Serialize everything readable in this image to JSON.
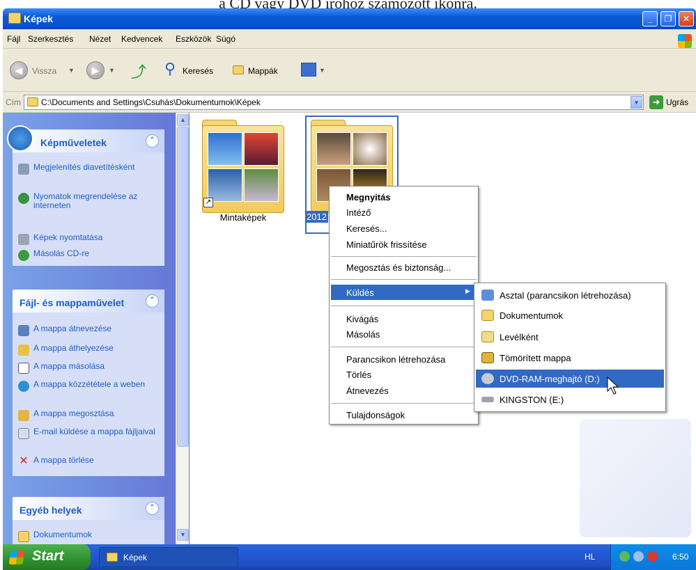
{
  "caption": "a CD vagy DVD íróhoz számozott ikonra.",
  "window": {
    "title": "Képek"
  },
  "menubar": [
    "Fájl",
    "Szerkesztés",
    "Nézet",
    "Kedvencek",
    "Eszközök",
    "Súgó"
  ],
  "toolbar": {
    "back": "Vissza",
    "search": "Keresés",
    "folders": "Mappák"
  },
  "address": {
    "label": "Cím",
    "path": "C:\\Documents and Settings\\Csuhás\\Dokumentumok\\Képek",
    "go": "Ugrás"
  },
  "sidebar": {
    "picture_tasks": {
      "title": "Képműveletek",
      "items": [
        "Megjelenítés diavetítésként",
        "Nyomatok megrendelése az interneten",
        "Képek nyomtatása",
        "Másolás CD-re"
      ]
    },
    "file_tasks": {
      "title": "Fájl- és mappaművelet",
      "items": [
        "A mappa átnevezése",
        "A mappa áthelyezése",
        "A mappa másolása",
        "A mappa közzététele a weben",
        "A mappa megosztása",
        "E-mail küldése a mappa fájljaival",
        "A mappa törlése"
      ]
    },
    "other_places": {
      "title": "Egyéb helyek",
      "items": [
        "Dokumentumok"
      ]
    }
  },
  "folders": [
    {
      "name": "Mintaképek"
    },
    {
      "name": "2012"
    }
  ],
  "context_menu": [
    "Megnyitás",
    "Intéző",
    "Keresés...",
    "Miniatűrök frissítése",
    "Megosztás és biztonság...",
    "Küldés",
    "Kivágás",
    "Másolás",
    "Parancsikon létrehozása",
    "Törlés",
    "Átnevezés",
    "Tulajdonságok"
  ],
  "send_to_menu": [
    "Asztal (parancsikon létrehozása)",
    "Dokumentumok",
    "Levélként",
    "Tömörített mappa",
    "DVD-RAM-meghajtó (D:)",
    "KINGSTON (E:)"
  ],
  "taskbar": {
    "start": "Start",
    "item": "Képek",
    "lang": "HL",
    "clock": "6:50"
  },
  "colors": {
    "highlight": "#316ac5",
    "title_blue": "#0a5ad8",
    "panel_text": "#215dc6"
  }
}
